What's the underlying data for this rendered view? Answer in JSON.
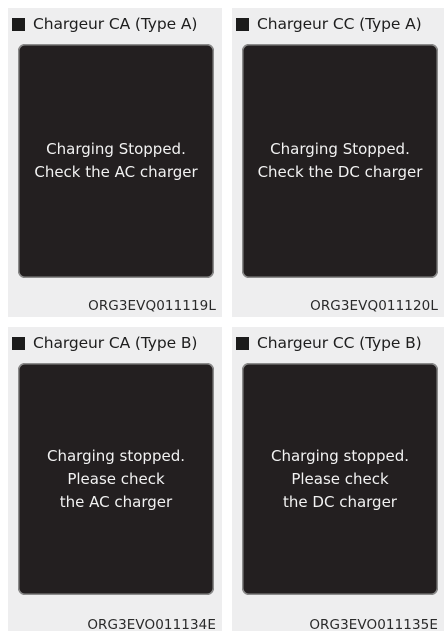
{
  "panels": [
    {
      "title": "Chargeur CA (Type A)",
      "message": [
        "Charging Stopped.",
        "Check the AC charger"
      ],
      "code": "ORG3EVQ011119L"
    },
    {
      "title": "Chargeur CC (Type A)",
      "message": [
        "Charging Stopped.",
        "Check the DC charger"
      ],
      "code": "ORG3EVQ011120L"
    },
    {
      "title": "Chargeur CA (Type B)",
      "message": [
        "Charging stopped.",
        "Please check",
        "the AC charger"
      ],
      "code": "ORG3EVO011134E"
    },
    {
      "title": "Chargeur CC (Type B)",
      "message": [
        "Charging stopped.",
        "Please check",
        "the DC charger"
      ],
      "code": "ORG3EVO011135E"
    }
  ],
  "colors": {
    "panel_bg": "#eeeeef",
    "screen_bg": "#231f20",
    "screen_text": "#f2f2f2"
  },
  "icons": {
    "bullet": "square-bullet-icon"
  }
}
